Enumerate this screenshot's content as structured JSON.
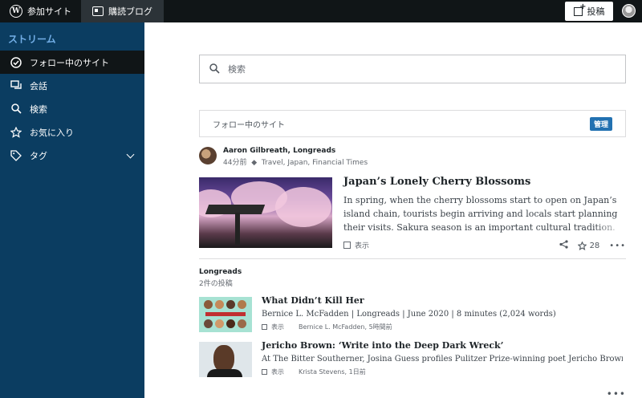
{
  "topbar": {
    "sites_label": "参加サイト",
    "reader_label": "購読ブログ",
    "post_label": "投稿"
  },
  "sidebar": {
    "heading": "ストリーム",
    "items": [
      {
        "label": "フォロー中のサイト",
        "icon": "check-circle-icon",
        "active": true
      },
      {
        "label": "会話",
        "icon": "chat-icon"
      },
      {
        "label": "検索",
        "icon": "search-icon"
      },
      {
        "label": "お気に入り",
        "icon": "star-icon"
      },
      {
        "label": "タグ",
        "icon": "tag-icon"
      }
    ]
  },
  "search": {
    "placeholder": "検索"
  },
  "following": {
    "label": "フォロー中のサイト",
    "manage_label": "管理"
  },
  "post1": {
    "author": "Aaron Gilbreath, Longreads",
    "time": "44分前",
    "tags": "Travel, Japan, Financial Times",
    "title": "Japan’s Lonely Cherry Blossoms",
    "excerpt": "In spring, when the cherry blossoms start to open on Japan’s island chain, tourists begin arriving and locals start planning their visits. Sakura season is an important cultural tradition. People plan spring",
    "view_label": "表示",
    "likes": "28"
  },
  "group": {
    "name": "Longreads",
    "count": "2件の投稿",
    "posts": [
      {
        "title": "What Didn’t Kill Her",
        "excerpt": "Bernice L. McFadden | Longreads | June 2020 | 8 minutes (2,024 words)",
        "view_label": "表示",
        "byline": "Bernice L. McFadden, 5時間前"
      },
      {
        "title": "Jericho Brown: ‘Write into the Deep Dark Wreck’",
        "excerpt": "At The Bitter Southerner, Josina Guess profiles Pulitzer Prize-winning poet Jericho Brown",
        "view_label": "表示",
        "byline": "Krista Stevens, 1日前"
      }
    ]
  },
  "colors": {
    "sidebar_bg": "#0b3d61",
    "topbar_bg": "#101517",
    "accent": "#2271b1",
    "sidebar_heading": "#72aee6"
  }
}
